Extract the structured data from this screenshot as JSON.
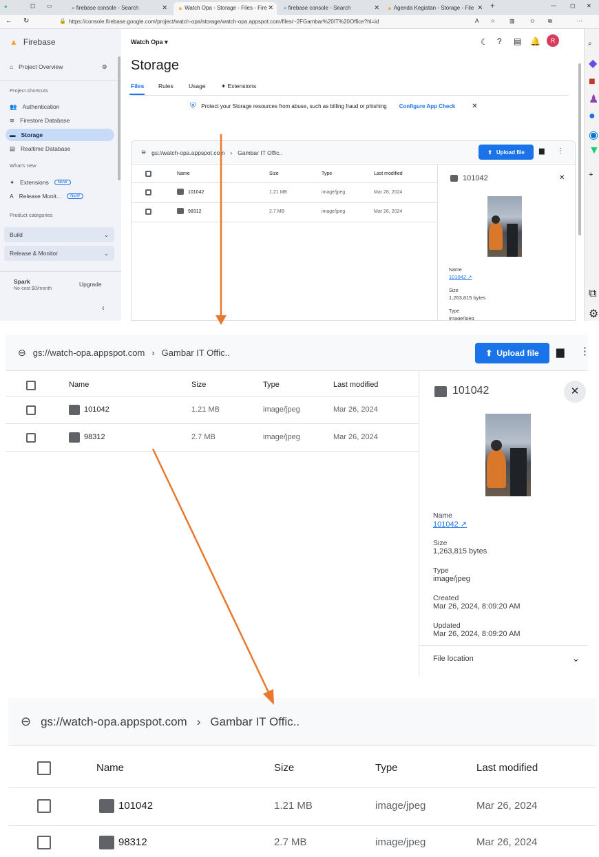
{
  "browser": {
    "tabs": [
      {
        "label": "firebase console - Search"
      },
      {
        "label": "Watch Opa - Storage - Files - Fire"
      },
      {
        "label": "firebase console - Search"
      },
      {
        "label": "Agenda Kegiatan - Storage - File"
      }
    ],
    "new_tab": "+",
    "url": "https://console.firebase.google.com/project/watch-opa/storage/watch-opa.appspot.com/files/~2FGambar%20IT%20Office?hl=id"
  },
  "sidebar": {
    "brand": "Firebase",
    "project_overview": "Project Overview",
    "shortcuts_label": "Project shortcuts",
    "items": [
      "Authentication",
      "Firestore Database",
      "Storage",
      "Realtime Database"
    ],
    "whats_new_label": "What's new",
    "new_items": [
      "Extensions",
      "Release Monit..."
    ],
    "new_badge": "NEW",
    "categories_label": "Product categories",
    "categories": [
      "Build",
      "Release & Monitor"
    ],
    "plan": "Spark",
    "plan_sub": "No-cost $0/month",
    "upgrade": "Upgrade"
  },
  "header": {
    "project": "Watch Opa",
    "title": "Storage",
    "tabs": [
      "Files",
      "Rules",
      "Usage",
      "Extensions"
    ],
    "banner_text": "Protect your Storage resources from abuse, such as billing fraud or phishing",
    "banner_link": "Configure App Check",
    "avatar": "R"
  },
  "browser_files": {
    "bucket": "gs://watch-opa.appspot.com",
    "folder": "Gambar IT Offic..",
    "upload_label": "Upload file",
    "columns": [
      "Name",
      "Size",
      "Type",
      "Last modified"
    ],
    "rows": [
      {
        "name": "101042",
        "size": "1.21 MB",
        "type": "image/jpeg",
        "modified": "Mar 26, 2024"
      },
      {
        "name": "98312",
        "size": "2.7 MB",
        "type": "image/jpeg",
        "modified": "Mar 26, 2024"
      }
    ]
  },
  "detail": {
    "file_name": "101042",
    "name_label": "Name",
    "name_value": "101042",
    "size_label": "Size",
    "size_value": "1,263,815 bytes",
    "type_label": "Type",
    "type_value": "image/jpeg",
    "type_value_cut": "image/jpeg",
    "created_label": "Created",
    "created_value": "Mar 26, 2024, 8:09:20 AM",
    "updated_label": "Updated",
    "updated_value": "Mar 26, 2024, 8:09:20 AM",
    "file_location": "File location"
  },
  "colors": {
    "accent": "#1a73e8",
    "arrow": "#e8782d",
    "sidebar": "#f1f3f8"
  }
}
